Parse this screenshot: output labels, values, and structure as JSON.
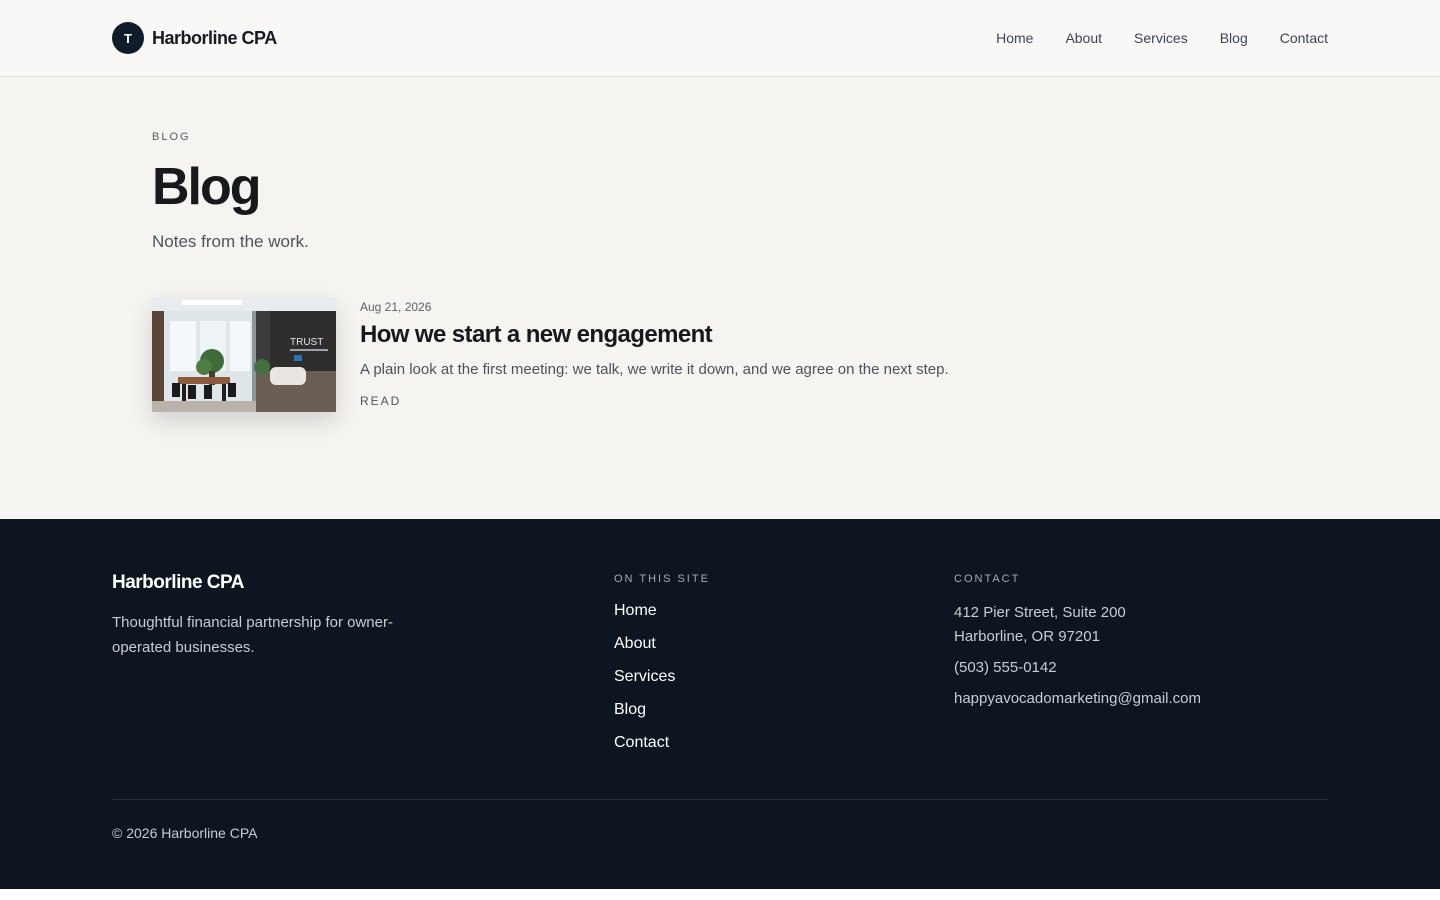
{
  "header": {
    "logo_letter": "T",
    "brand": "Harborline CPA",
    "nav": [
      {
        "label": "Home"
      },
      {
        "label": "About"
      },
      {
        "label": "Services"
      },
      {
        "label": "Blog"
      },
      {
        "label": "Contact"
      }
    ]
  },
  "hero": {
    "eyebrow": "BLOG",
    "title": "Blog",
    "subtitle": "Notes from the work."
  },
  "posts": [
    {
      "date": "Aug 21, 2026",
      "title": "How we start a new engagement",
      "excerpt": "A plain look at the first meeting: we talk, we write it down, and we agree on the next step.",
      "read_label": "READ",
      "image_sign": "TRUST"
    }
  ],
  "footer": {
    "brand": "Harborline CPA",
    "tagline": "Thoughtful financial partnership for owner-operated businesses.",
    "site_heading": "ON THIS SITE",
    "site_links": [
      {
        "label": "Home"
      },
      {
        "label": "About"
      },
      {
        "label": "Services"
      },
      {
        "label": "Blog"
      },
      {
        "label": "Contact"
      }
    ],
    "contact_heading": "CONTACT",
    "address_line1": "412 Pier Street, Suite 200",
    "address_line2": "Harborline, OR 97201",
    "phone": "(503) 555-0142",
    "email": "happyavocadomarketing@gmail.com",
    "copyright": "© 2026 Harborline CPA"
  },
  "colors": {
    "header_bg": "#f9f8f6",
    "page_bg": "#f5f4f1",
    "footer_bg": "#0c1520",
    "logo_bg": "#111c2b"
  }
}
